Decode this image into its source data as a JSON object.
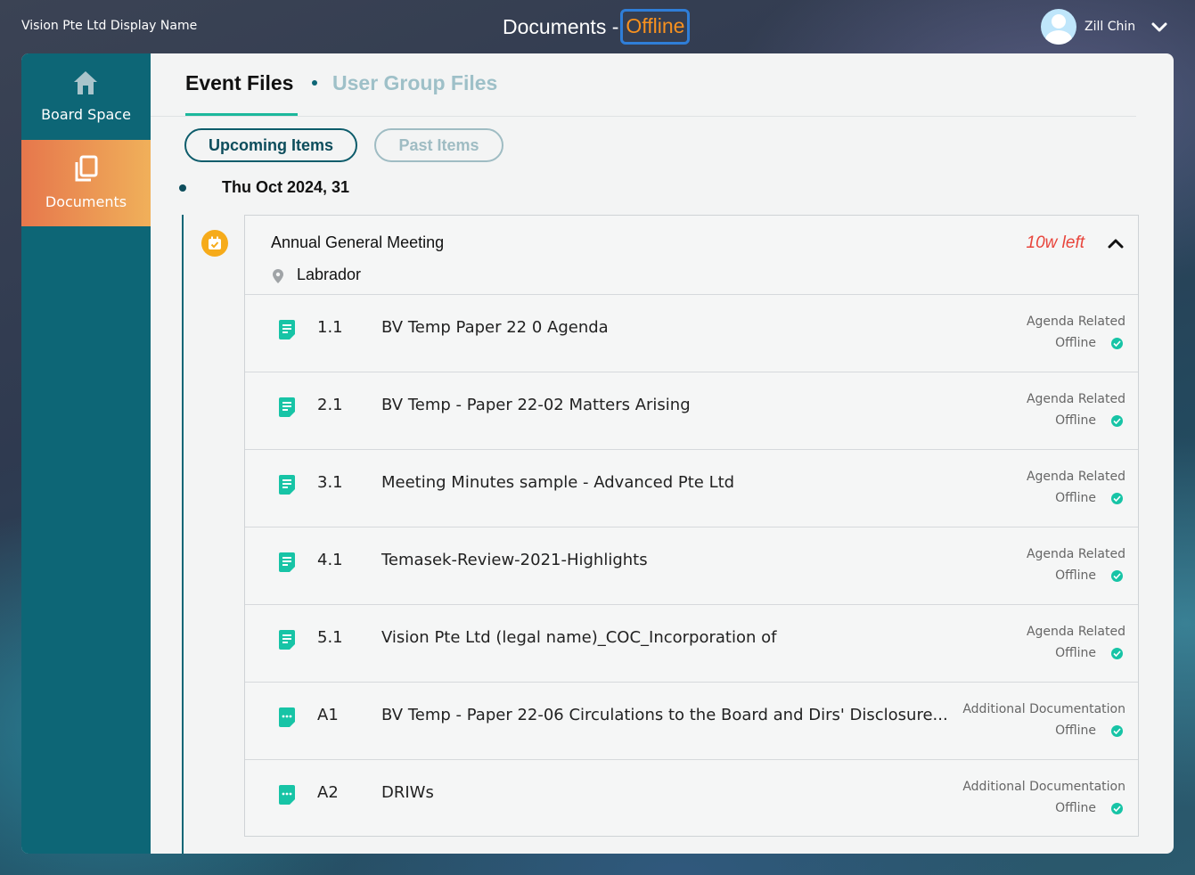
{
  "header": {
    "org_name": "Vision Pte Ltd Display Name",
    "title": "Documents -",
    "title_status": "Offline",
    "user_name": "Zill Chin"
  },
  "sidebar": {
    "items": [
      {
        "label": "Board Space",
        "icon": "home-icon"
      },
      {
        "label": "Documents",
        "icon": "documents-icon",
        "active": true
      }
    ]
  },
  "tabs": {
    "event_files": "Event Files",
    "user_group_files": "User Group Files"
  },
  "filters": {
    "upcoming": "Upcoming Items",
    "past": "Past Items"
  },
  "event": {
    "date": "Thu Oct 2024, 31",
    "title": "Annual General Meeting",
    "time_left": "10w left",
    "location": "Labrador",
    "documents": [
      {
        "num": "1.1",
        "title": "BV Temp  Paper 22 0 Agenda",
        "category": "Agenda Related",
        "status": "Offline",
        "icon": "doc-lines-icon"
      },
      {
        "num": "2.1",
        "title": "BV Temp - Paper 22-02 Matters Arising",
        "category": "Agenda Related",
        "status": "Offline",
        "icon": "doc-lines-icon"
      },
      {
        "num": "3.1",
        "title": "Meeting Minutes sample -  Advanced Pte Ltd",
        "category": "Agenda Related",
        "status": "Offline",
        "icon": "doc-lines-icon"
      },
      {
        "num": "4.1",
        "title": "Temasek-Review-2021-Highlights",
        "category": "Agenda Related",
        "status": "Offline",
        "icon": "doc-lines-icon"
      },
      {
        "num": "5.1",
        "title": "Vision Pte Ltd (legal name)_COC_Incorporation of",
        "category": "Agenda Related",
        "status": "Offline",
        "icon": "doc-lines-icon"
      },
      {
        "num": "A1",
        "title": "BV Temp - Paper 22-06 Circulations to the Board and Dirs' Disclosure...",
        "category": "Additional Documentation",
        "status": "Offline",
        "icon": "doc-dots-icon"
      },
      {
        "num": "A2",
        "title": "DRIWs",
        "category": "Additional Documentation",
        "status": "Offline",
        "icon": "doc-dots-icon"
      }
    ]
  },
  "colors": {
    "sidebar": "#0d6676",
    "active_gradient_start": "#e6774c",
    "active_gradient_end": "#f0b05a",
    "accent": "#1cb89c",
    "offline_orange": "#f7911f",
    "time_left_red": "#e8453c"
  }
}
